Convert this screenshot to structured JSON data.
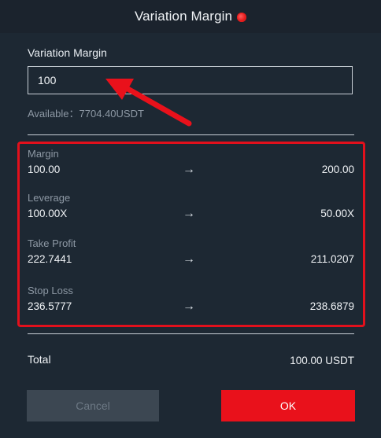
{
  "dialog": {
    "title": "Variation Margin",
    "help_icon": "help-icon",
    "field_label": "Variation Margin",
    "input_value": "100",
    "available_label": "Available：",
    "available_value": "7704.40USDT",
    "changes": [
      {
        "label": "Margin",
        "from": "100.00",
        "arrow": "→",
        "to": "200.00"
      },
      {
        "label": "Leverage",
        "from": "100.00X",
        "arrow": "→",
        "to": "50.00X"
      },
      {
        "label": "Take Profit",
        "from": "222.7441",
        "arrow": "→",
        "to": "211.0207"
      },
      {
        "label": "Stop Loss",
        "from": "236.5777",
        "arrow": "→",
        "to": "238.6879"
      }
    ],
    "total_label": "Total",
    "total_value": "100.00 USDT",
    "cancel_label": "Cancel",
    "ok_label": "OK"
  },
  "colors": {
    "background": "#1d2833",
    "header": "#1b232d",
    "accent_red": "#e9111b",
    "muted_text": "#8d98a4",
    "cancel_bg": "#3c4752"
  },
  "annotations": {
    "pointer_arrow_icon": "red-arrow-icon",
    "highlight_box_color": "#e2101c"
  }
}
